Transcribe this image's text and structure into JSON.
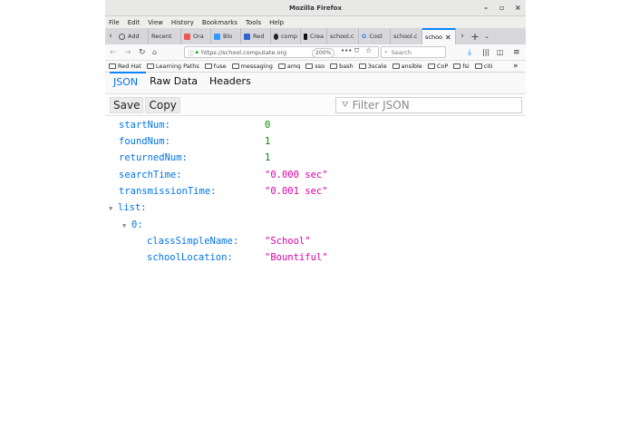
{
  "window": {
    "title": "Mozilla Firefox"
  },
  "menu": [
    "File",
    "Edit",
    "View",
    "History",
    "Bookmarks",
    "Tools",
    "Help"
  ],
  "tabs": [
    {
      "label": "Add",
      "color": "#555"
    },
    {
      "label": "Recent",
      "color": "#999"
    },
    {
      "label": "Ora",
      "color": "#e55"
    },
    {
      "label": "Blo",
      "color": "#39f"
    },
    {
      "label": "Red",
      "color": "#36c"
    },
    {
      "label": "comp",
      "color": "#222"
    },
    {
      "label": "Crea",
      "color": "#111"
    },
    {
      "label": "school.c",
      "color": "#999"
    },
    {
      "label": "Cost",
      "color": "#4285f4"
    },
    {
      "label": "school.c",
      "color": "#999"
    },
    {
      "label": "schoo",
      "color": "#999"
    }
  ],
  "nav": {
    "url": "https://school.computate.org",
    "zoom": "200%",
    "search_placeholder": "Search"
  },
  "bookmarks": [
    "Red Hat",
    "Learning Paths",
    "fuse",
    "messaging",
    "amq",
    "sso",
    "bash",
    "3scale",
    "ansible",
    "CoP",
    "fsi",
    "citi"
  ],
  "viewer": {
    "tabs": [
      "JSON",
      "Raw Data",
      "Headers"
    ],
    "save": "Save",
    "copy": "Copy",
    "filter_placeholder": "Filter JSON"
  },
  "json": {
    "startNum": {
      "key": "startNum:",
      "value": "0"
    },
    "foundNum": {
      "key": "foundNum:",
      "value": "1"
    },
    "returnedNum": {
      "key": "returnedNum:",
      "value": "1"
    },
    "searchTime": {
      "key": "searchTime:",
      "value": "\"0.000 sec\""
    },
    "transmissionTime": {
      "key": "transmissionTime:",
      "value": "\"0.001 sec\""
    },
    "list": {
      "key": "list:"
    },
    "item0": {
      "key": "0:"
    },
    "classSimpleName": {
      "key": "classSimpleName:",
      "value": "\"School\""
    },
    "schoolLocation": {
      "key": "schoolLocation:",
      "value": "\"Bountiful\""
    }
  }
}
